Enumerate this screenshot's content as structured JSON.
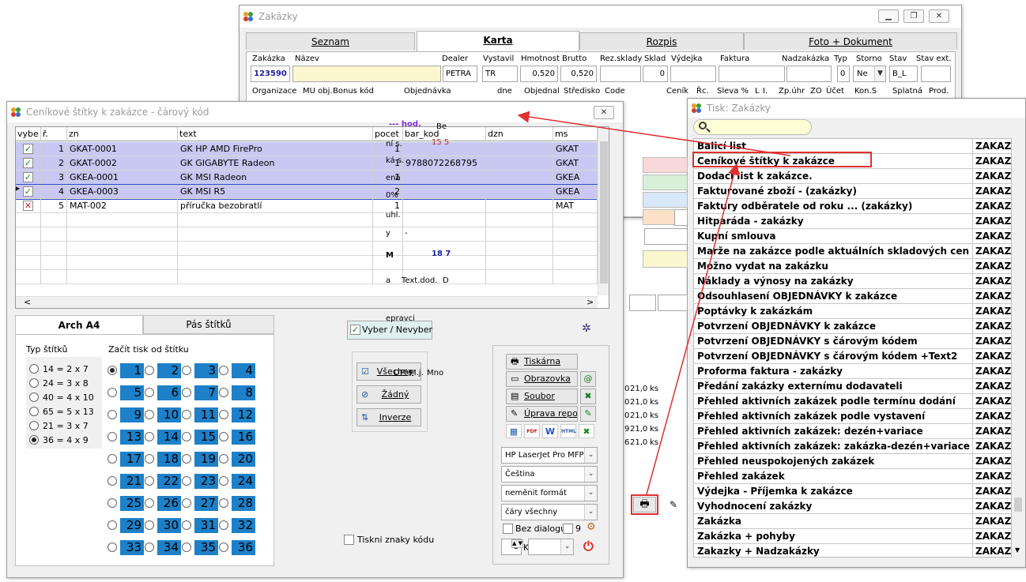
{
  "zakazky": {
    "title": "Zakázky",
    "tabs": [
      "Seznam",
      "Karta",
      "Rozpis",
      "Foto + Dokument"
    ],
    "labels_row1": [
      "Zakázka",
      "Název",
      "Dealer",
      "Vystavil",
      "Hmotnost",
      "Brutto",
      "Rez.sklady",
      "Sklad",
      "Výdejka",
      "Faktura",
      "Nadzakázka",
      "Typ",
      "Storno",
      "Stav",
      "Stav ext."
    ],
    "values": {
      "zakazka": "123590",
      "dealer": "PETRA",
      "vystavil": "TR",
      "hmotnost": "0,520",
      "brutto": "0,520",
      "sklad": "0",
      "typ": "0",
      "storno": "Ne",
      "stav": "B_L"
    },
    "labels_row2": [
      "Organizace",
      "MU obj.",
      "Bonus kód",
      "Objednávka",
      "dne",
      "Objednal",
      "Středisko",
      "Code",
      "Ceník",
      "Řc.",
      "Sleva %",
      "L",
      "I.",
      "Zp.úhr",
      "ZO",
      "Účet",
      "Kon.S",
      "Splatná",
      "Prod."
    ],
    "partial": {
      "hod": "--- hod.",
      "be": "Be",
      "v15": "15 5",
      "ns": "ní s.",
      "ks": "ká s.",
      "ena": "ená",
      "pct": "0%",
      "uhl": "uhl.",
      "y": "y",
      "dash": "-",
      "m": "M",
      "v18": "18 7",
      "a": "a",
      "textdod": "Text.dod.",
      "d": "D",
      "prac": "epravci",
      "dph": "DPH",
      "mj": "M.j.",
      "mn": "Mno"
    },
    "rows": [
      {
        "a": "0",
        "b": "21,0",
        "c": "ks"
      },
      {
        "a": "0",
        "b": "21,0",
        "c": "ks"
      },
      {
        "a": "0",
        "b": "21,0",
        "c": "ks"
      },
      {
        "a": "9",
        "b": "21,0",
        "c": "ks"
      },
      {
        "a": "6",
        "b": "21,0",
        "c": "ks"
      }
    ]
  },
  "cenik": {
    "title": "Ceníkové štítky k zakázce - čárový kód",
    "columns": [
      "vybe",
      "ř.",
      "zn",
      "text",
      "pocet",
      "bar_kod",
      "dzn",
      "ms"
    ],
    "rows": [
      {
        "vybe": true,
        "r": "1",
        "zn": "GKAT-0001",
        "text": "GK HP AMD FirePro",
        "pocet": "1",
        "bar_kod": "",
        "dzn": "",
        "ms": "GKAT"
      },
      {
        "vybe": true,
        "r": "2",
        "zn": "GKAT-0002",
        "text": "GK  GIGABYTE Radeon",
        "pocet": "1",
        "bar_kod": "9788072268795",
        "dzn": "",
        "ms": "GKAT"
      },
      {
        "vybe": true,
        "r": "3",
        "zn": "GKEA-0001",
        "text": "GK MSI  Radeon",
        "pocet": "1",
        "bar_kod": "",
        "dzn": "",
        "ms": "GKEA"
      },
      {
        "vybe": true,
        "r": "4",
        "zn": "GKEA-0003",
        "text": "GK MSI R5",
        "pocet": "2",
        "bar_kod": "",
        "dzn": "",
        "ms": "GKEA"
      },
      {
        "vybe": false,
        "r": "5",
        "zn": "MAT-002",
        "text": "příručka bezobratlí",
        "pocet": "1",
        "bar_kod": "",
        "dzn": "",
        "ms": "MAT"
      }
    ],
    "tabs": [
      "Arch A4",
      "Pás štítků"
    ],
    "typ_label": "Typ štítků",
    "typ_options": [
      "14 = 2 x 7",
      "24 = 3 x 8",
      "40 = 4 x 10",
      "65 = 5 x 13",
      "21 = 3 x 7",
      "36 = 4 x 9"
    ],
    "typ_selected": 5,
    "start_label": "Začít tisk od štítku",
    "start_selected": 1,
    "vyber_label": "Vyber / Nevyber",
    "vsechny": "Všechny",
    "zadny": "Žádný",
    "inverze": "Inverze",
    "tiskni_znaky": "Tiskni znaky kódu",
    "out_buttons": [
      "Tiskárna",
      "Obrazovka",
      "Soubor",
      "Úprava report"
    ],
    "printer": "HP LaserJet Pro MFP",
    "language": "Čeština",
    "format": "neměnit formát",
    "lines": "čáry všechny",
    "bez_dialogu": "Bez dialogu",
    "nine": "9",
    "copies": "1",
    "k": "K"
  },
  "tisk": {
    "title": "Tisk: Zakázky",
    "items": [
      {
        "name": "Balicí list",
        "code": "ZAKAZK"
      },
      {
        "name": "Ceníkové štítky k zakázce",
        "code": "ZAKAZK"
      },
      {
        "name": "Dodací list k zakázce.",
        "code": "ZAKAZK"
      },
      {
        "name": "Fakturované zboží - (zakázky)",
        "code": "ZAKAZK"
      },
      {
        "name": "Faktury odběratele od roku ... (zakázky)",
        "code": "ZAKAZK"
      },
      {
        "name": "Hitparáda - zakázky",
        "code": "ZAKAZK"
      },
      {
        "name": "Kupní smlouva",
        "code": "ZAKAZK"
      },
      {
        "name": "Marže na zakázce podle aktuálních skladových cen",
        "code": "ZAKAZK"
      },
      {
        "name": "Možno vydat na zakázku",
        "code": "ZAKAZK"
      },
      {
        "name": "Náklady a výnosy na zakázky",
        "code": "ZAKAZK"
      },
      {
        "name": "Odsouhlasení OBJEDNÁVKY k zakázce",
        "code": "ZAKAZK"
      },
      {
        "name": "Poptávky k zakázkám",
        "code": "ZAKAZK"
      },
      {
        "name": "Potvrzení OBJEDNÁVKY k zakázce",
        "code": "ZAKAZK"
      },
      {
        "name": "Potvrzení OBJEDNÁVKY s čárovým kódem",
        "code": "ZAKAZK"
      },
      {
        "name": "Potvrzení OBJEDNÁVKY s čárovým kódem +Text2",
        "code": "ZAKAZK"
      },
      {
        "name": "Proforma faktura - zakázky",
        "code": "ZAKAZK"
      },
      {
        "name": "Předání zakázky externímu dodavateli",
        "code": "ZAKAZK"
      },
      {
        "name": "Přehled aktivních zakázek podle termínu dodání",
        "code": "ZAKAZK"
      },
      {
        "name": "Přehled aktivních zakázek podle vystavení",
        "code": "ZAKAZK"
      },
      {
        "name": "Přehled aktivních zakázek: dezén+variace",
        "code": "ZAKAZK"
      },
      {
        "name": "Přehled aktivních zakázek: zakázka-dezén+variace",
        "code": "ZAKAZK"
      },
      {
        "name": "Přehled neuspokojených zakázek",
        "code": "ZAKAZK"
      },
      {
        "name": "Přehled zakázek",
        "code": "ZAKAZK"
      },
      {
        "name": "Výdejka - Příjemka k zakázce",
        "code": "ZAKAZK"
      },
      {
        "name": "Vyhodnocení zakázky",
        "code": "ZAKAZK"
      },
      {
        "name": "Zakázka",
        "code": "ZAKAZK"
      },
      {
        "name": "Zakázka + pohyby",
        "code": "ZAKAZK"
      },
      {
        "name": "Zakazky + Nadzakázky",
        "code": "ZAKAZK"
      }
    ]
  },
  "colors": {
    "selected_row": "#c8c8f2",
    "label_blue": "#1d80c8",
    "highlight_red": "#e03030",
    "name_field": "#fdf7cf"
  }
}
